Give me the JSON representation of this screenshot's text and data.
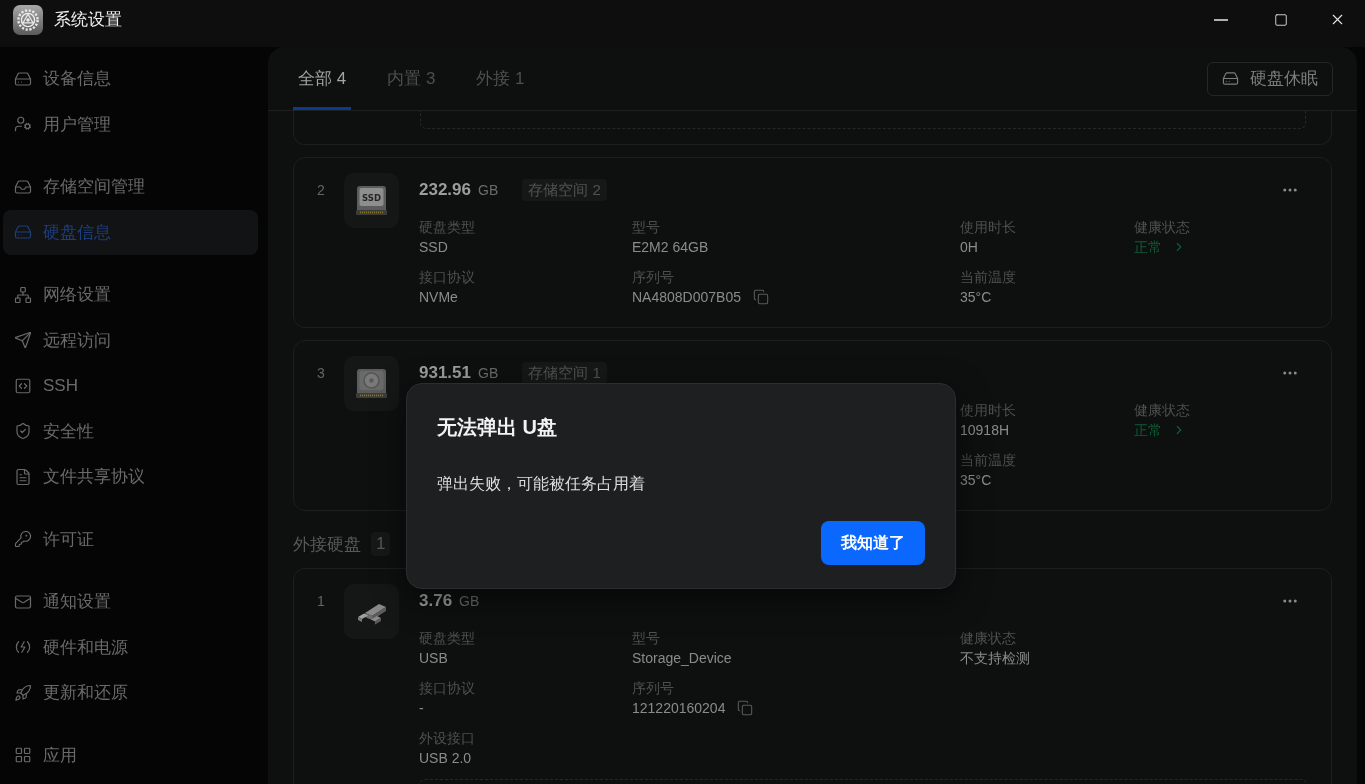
{
  "window": {
    "title": "系统设置"
  },
  "sidebar": {
    "groups": [
      {
        "items": [
          {
            "label": "设备信息",
            "selected": false
          },
          {
            "label": "用户管理",
            "selected": false
          }
        ]
      },
      {
        "items": [
          {
            "label": "存储空间管理",
            "selected": false
          },
          {
            "label": "硬盘信息",
            "selected": true
          }
        ]
      },
      {
        "items": [
          {
            "label": "网络设置",
            "selected": false
          },
          {
            "label": "远程访问",
            "selected": false
          },
          {
            "label": "SSH",
            "selected": false
          },
          {
            "label": "安全性",
            "selected": false
          },
          {
            "label": "文件共享协议",
            "selected": false
          }
        ]
      },
      {
        "items": [
          {
            "label": "许可证",
            "selected": false
          }
        ]
      },
      {
        "items": [
          {
            "label": "通知设置",
            "selected": false
          },
          {
            "label": "硬件和电源",
            "selected": false
          },
          {
            "label": "更新和还原",
            "selected": false
          }
        ]
      },
      {
        "items": [
          {
            "label": "应用",
            "selected": false
          }
        ]
      }
    ]
  },
  "tabs": [
    {
      "label": "全部 4",
      "selected": true
    },
    {
      "label": "内置 3",
      "selected": false
    },
    {
      "label": "外接 1",
      "selected": false
    }
  ],
  "header_button": {
    "label": "硬盘休眠"
  },
  "sections": [
    {
      "cards": [
        {
          "kind": "partial",
          "frame": true
        },
        {
          "kind": "ssd",
          "index": "2",
          "media_label": "SSD",
          "capacity": "232.96",
          "unit": "GB",
          "tag": "存储空间 2",
          "columns": [
            {
              "kind": "basic",
              "fields": [
                {
                  "kind": "text",
                  "label": "硬盘类型",
                  "value": "SSD"
                },
                {
                  "kind": "text",
                  "label": "接口协议",
                  "value": "NVMe"
                }
              ]
            },
            {
              "kind": "model",
              "fields": [
                {
                  "kind": "text",
                  "label": "型号",
                  "value": "E2M2 64GB"
                },
                {
                  "kind": "copy",
                  "label": "序列号",
                  "value": "NA4808D007B05"
                }
              ]
            },
            {
              "kind": "usage",
              "fields": [
                {
                  "kind": "text",
                  "label": "使用时长",
                  "value": "0H"
                },
                {
                  "kind": "text",
                  "label": "当前温度",
                  "value": "35°C"
                }
              ]
            },
            {
              "kind": "health",
              "fields": [
                {
                  "kind": "status",
                  "label": "健康状态",
                  "value": "正常",
                  "healthy": true
                }
              ]
            }
          ]
        },
        {
          "kind": "hdd",
          "index": "3",
          "capacity": "931.51",
          "unit": "GB",
          "tag": "存储空间 1",
          "columns": [
            {
              "kind": "usage",
              "fields": [
                {
                  "kind": "text",
                  "label": "使用时长",
                  "value": "10918H"
                },
                {
                  "kind": "text",
                  "label": "当前温度",
                  "value": "35°C"
                }
              ]
            },
            {
              "kind": "health",
              "fields": [
                {
                  "kind": "status",
                  "label": "健康状态",
                  "value": "正常",
                  "healthy": true
                }
              ]
            }
          ]
        }
      ]
    },
    {
      "title": "外接硬盘",
      "count": "1",
      "cards": [
        {
          "kind": "usb",
          "index": "1",
          "capacity": "3.76",
          "unit": "GB",
          "frame": true,
          "columns": [
            {
              "kind": "basic",
              "fields": [
                {
                  "kind": "text",
                  "label": "硬盘类型",
                  "value": "USB"
                },
                {
                  "kind": "text",
                  "label": "接口协议",
                  "value": "-"
                },
                {
                  "kind": "text",
                  "label": "外设接口",
                  "value": "USB 2.0"
                }
              ]
            },
            {
              "kind": "model",
              "fields": [
                {
                  "kind": "text",
                  "label": "型号",
                  "value": "Storage_Device"
                },
                {
                  "kind": "copy",
                  "label": "序列号",
                  "value": "121220160204"
                }
              ]
            },
            {
              "kind": "health",
              "fields": [
                {
                  "kind": "status",
                  "label": "健康状态",
                  "value": "不支持检测",
                  "healthy": false
                }
              ]
            }
          ]
        }
      ]
    }
  ],
  "dialog": {
    "title": "无法弹出 U盘",
    "message": "弹出失败，可能被任务占用着",
    "button": "我知道了"
  }
}
